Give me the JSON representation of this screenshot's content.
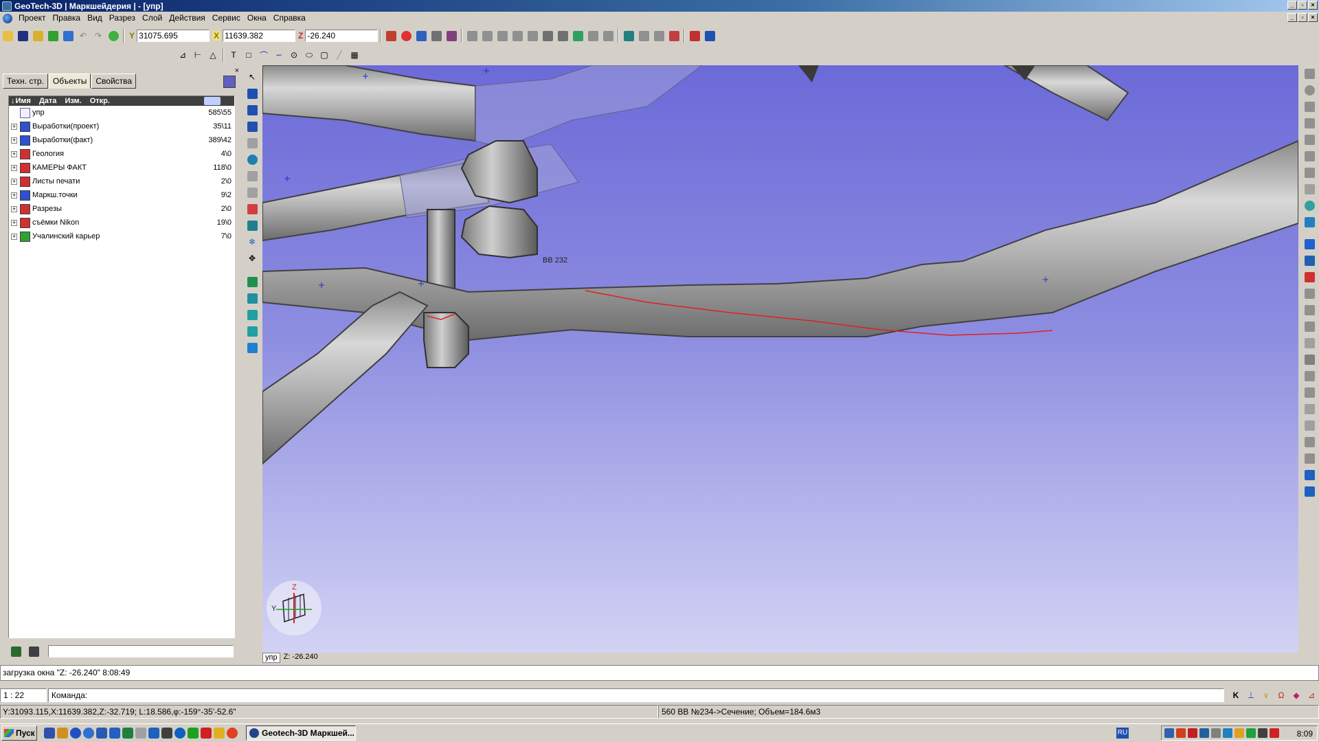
{
  "window": {
    "title": "GeoTech-3D | Маркшейдерия | - [упр]"
  },
  "menu": [
    "Проект",
    "Правка",
    "Вид",
    "Разрез",
    "Слой",
    "Действия",
    "Сервис",
    "Окна",
    "Справка"
  ],
  "coords": {
    "y_label": "Y",
    "y_value": "31075.695",
    "x_label": "X",
    "x_value": "11639.382",
    "z_label": "Z",
    "z_value": "-26.240"
  },
  "panel": {
    "tabs": [
      "Техн. стр.",
      "Объекты",
      "Свойства"
    ],
    "active_tab": "Объекты",
    "columns": [
      "Имя",
      "Дата",
      "Изм.",
      "Откр."
    ],
    "root": {
      "name": "упр",
      "count": "585\\55"
    },
    "items": [
      {
        "name": "Выработки(проект)",
        "count": "35\\11",
        "color": "#3050d0"
      },
      {
        "name": "Выработки(факт)",
        "count": "389\\42",
        "color": "#3050d0"
      },
      {
        "name": "Геология",
        "count": "4\\0",
        "color": "#d03030"
      },
      {
        "name": "КАМЕРЫ ФАКТ",
        "count": "118\\0",
        "color": "#d03030"
      },
      {
        "name": "Листы печати",
        "count": "2\\0",
        "color": "#d03030"
      },
      {
        "name": "Маркш.точки",
        "count": "9\\2",
        "color": "#3050d0"
      },
      {
        "name": "Разрезы",
        "count": "2\\0",
        "color": "#d03030"
      },
      {
        "name": "съёмки Nikon",
        "count": "19\\0",
        "color": "#d03030"
      },
      {
        "name": "Учалинский карьер",
        "count": "7\\0",
        "color": "#30a030"
      }
    ]
  },
  "viewport": {
    "label_bb": "BB 232",
    "axis_z": "Z",
    "axis_y": "Y",
    "tab_name": "упр",
    "tab_z": "Z: -26.240"
  },
  "messages": {
    "log": "загрузка окна \"Z: -26.240\" 8:08:49"
  },
  "command": {
    "scale": "1 : 22",
    "prompt": "Команда:"
  },
  "status": {
    "left": "Y:31093.115,X:11639.382,Z:-32.719; L:18.586,φ:-159°-35'-52.6\"",
    "right": "560 BB №234->Сечение; Объем=184.6м3"
  },
  "taskbar": {
    "start": "Пуск",
    "task": "Geotech-3D Маркшей...",
    "lang": "RU",
    "clock": "8:09"
  }
}
